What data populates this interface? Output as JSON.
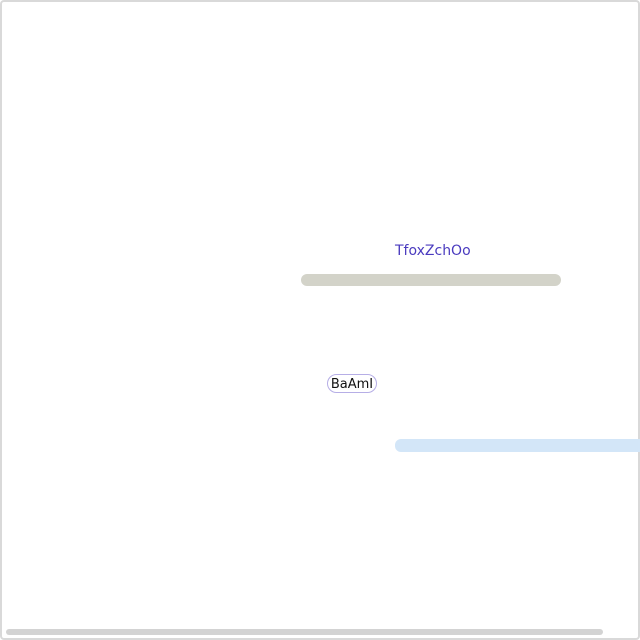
{
  "main": {
    "link_text": "TfoxZchOo",
    "chip_label": "BaAmI"
  },
  "colors": {
    "link": "#4a3bbf",
    "gray_bar": "#d3d3c9",
    "blue_bar": "#d3e6f8",
    "chip_border": "#b6aee6"
  }
}
